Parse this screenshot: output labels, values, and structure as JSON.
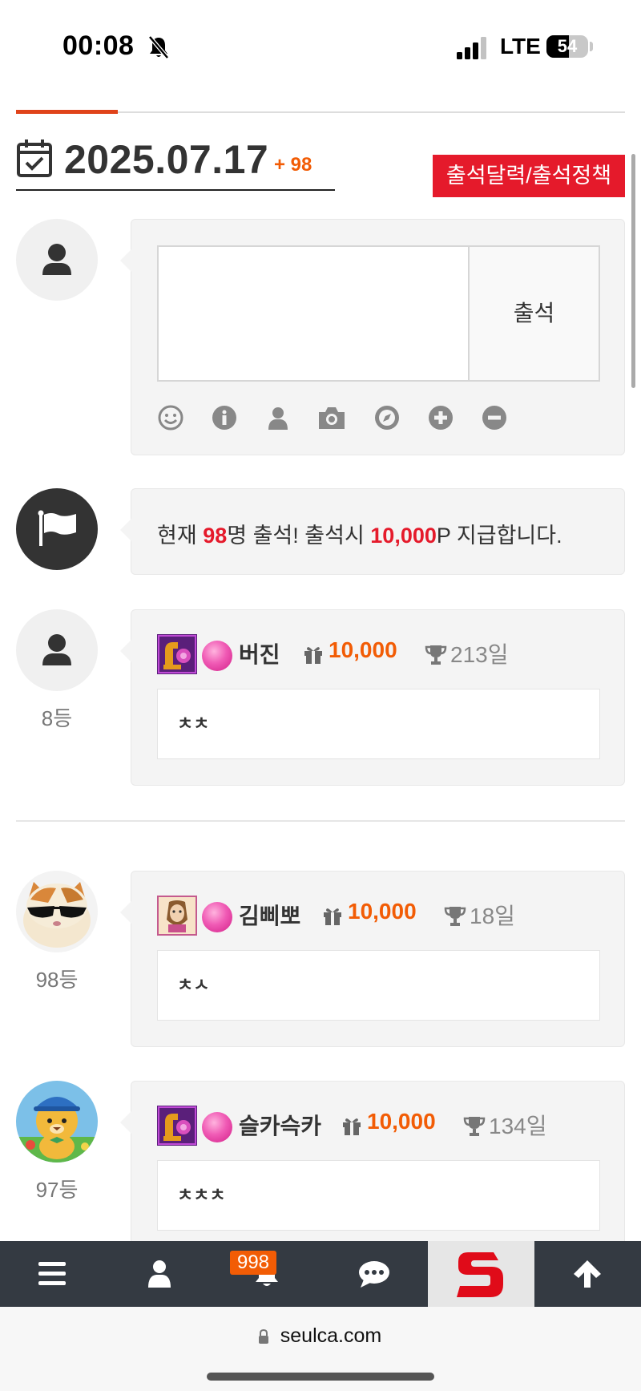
{
  "status_bar": {
    "time": "00:08",
    "network": "LTE",
    "battery": "54",
    "battery_level": 0.54
  },
  "header": {
    "date": "2025.07.17",
    "count": "+ 98",
    "policy_button": "출석달력/출석정책"
  },
  "compose": {
    "value": "",
    "placeholder": "",
    "submit_label": "출석",
    "tools": [
      "smile-icon",
      "info-icon",
      "user-icon",
      "camera-icon",
      "compass-icon",
      "plus-circle-icon",
      "minus-circle-icon"
    ]
  },
  "notice": {
    "prefix": "현재 ",
    "count": "98",
    "mid": "명 출석! 출석시 ",
    "points": "10,000",
    "suffix": "P 지급합니다."
  },
  "entries": [
    {
      "rank": "8등",
      "nickname": "버진",
      "points": "10,000",
      "days": "213일",
      "comment": "ㅊㅊ"
    },
    {
      "rank": "98등",
      "nickname": "김삐뽀",
      "points": "10,000",
      "days": "18일",
      "comment": "ㅊㅅ"
    },
    {
      "rank": "97등",
      "nickname": "슬카슥카",
      "points": "10,000",
      "days": "134일",
      "comment": "ㅊㅊㅊ"
    }
  ],
  "bottom_nav": {
    "items": [
      "menu-icon",
      "user-icon",
      "bell-icon",
      "chat-icon",
      "site-logo",
      "arrow-up-icon"
    ],
    "notification_count": "998"
  },
  "browser": {
    "url": "seulca.com"
  },
  "colors": {
    "accent": "#f25c05",
    "red": "#e51a2b",
    "nav_bg": "#343a42"
  }
}
